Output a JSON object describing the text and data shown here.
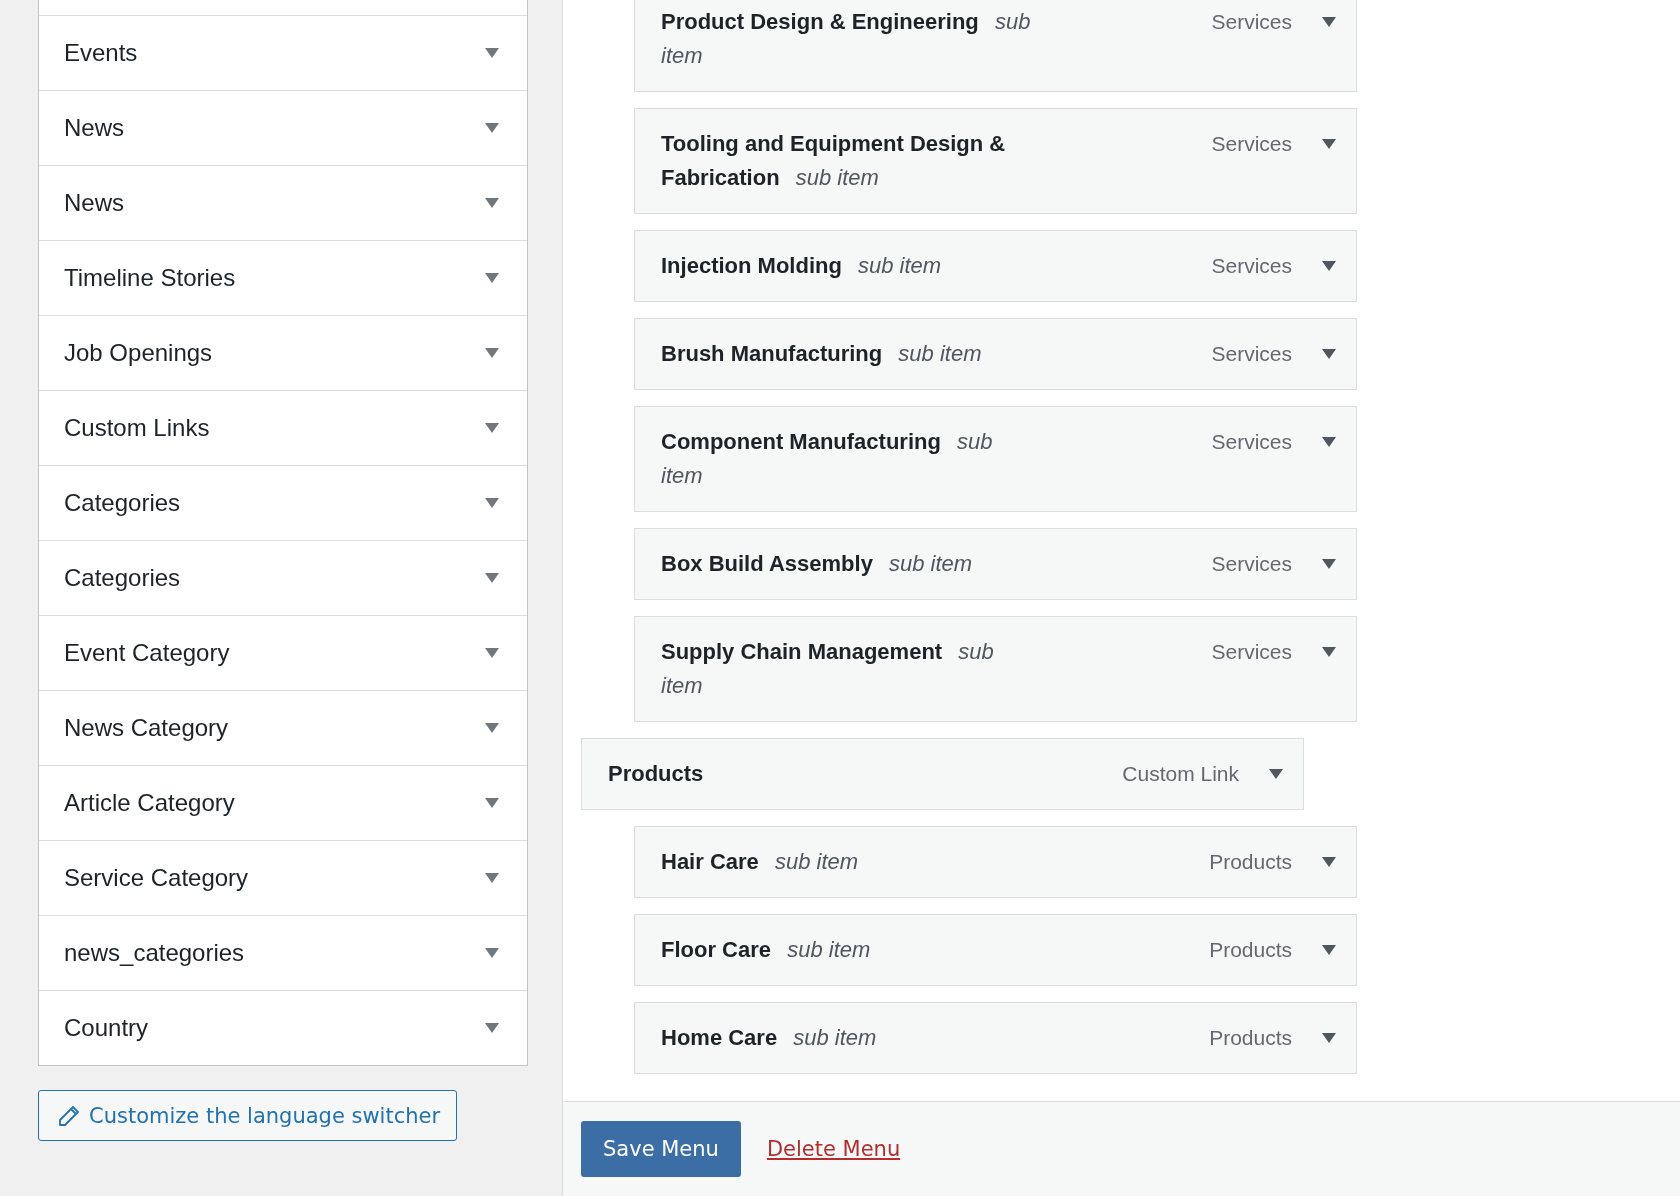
{
  "accordion_sections": [
    {
      "title": "Events",
      "expanded": false
    },
    {
      "title": "News",
      "expanded": false
    },
    {
      "title": "News",
      "expanded": false
    },
    {
      "title": "Timeline Stories",
      "expanded": false
    },
    {
      "title": "Job Openings",
      "expanded": false
    },
    {
      "title": "Custom Links",
      "expanded": false
    },
    {
      "title": "Categories",
      "expanded": false
    },
    {
      "title": "Categories",
      "expanded": false
    },
    {
      "title": "Event Category",
      "expanded": false
    },
    {
      "title": "News Category",
      "expanded": false
    },
    {
      "title": "Article Category",
      "expanded": false
    },
    {
      "title": "Service Category",
      "expanded": false
    },
    {
      "title": "news_categories",
      "expanded": false
    },
    {
      "title": "Country",
      "expanded": false
    }
  ],
  "language_switcher_button": "Customize the language switcher",
  "menu_items": [
    {
      "children": [
        {
          "title": "Product Design & Engineering",
          "note": "sub item",
          "type": "Services"
        },
        {
          "title": "Tooling and Equipment Design & Fabrication",
          "note": "sub item",
          "type": "Services"
        },
        {
          "title": "Injection Molding",
          "note": "sub item",
          "type": "Services"
        },
        {
          "title": "Brush Manufacturing",
          "note": "sub item",
          "type": "Services"
        },
        {
          "title": "Component Manufacturing",
          "note": "sub item",
          "type": "Services"
        },
        {
          "title": "Box Build Assembly",
          "note": "sub item",
          "type": "Services"
        },
        {
          "title": "Supply Chain Management",
          "note": "sub item",
          "type": "Services"
        }
      ]
    },
    {
      "title": "Products",
      "type": "Custom Link",
      "children": [
        {
          "title": "Hair Care",
          "note": "sub item",
          "type": "Products"
        },
        {
          "title": "Floor Care",
          "note": "sub item",
          "type": "Products"
        },
        {
          "title": "Home Care",
          "note": "sub item",
          "type": "Products"
        }
      ]
    }
  ],
  "footer": {
    "save_button": "Save Menu",
    "delete_link": "Delete Menu"
  }
}
